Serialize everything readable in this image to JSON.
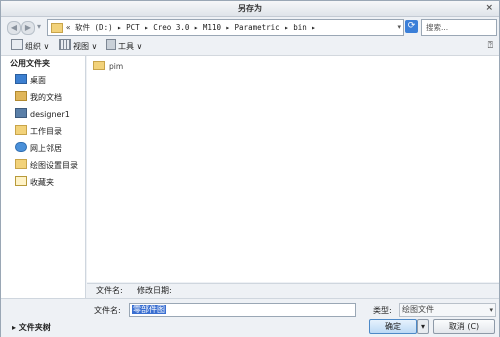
{
  "window": {
    "title": "另存为",
    "close_icon": "close-icon"
  },
  "nav": {
    "back_icon": "back-arrow-icon",
    "forward_icon": "forward-arrow-icon",
    "address_path": "« 软件 (D:) ▸ PCT ▸ Creo 3.0 ▸ M110 ▸ Parametric ▸ bin ▸",
    "search_placeholder": "搜索..."
  },
  "toolbar": {
    "organize": "组织 ∨",
    "views": "视图 ∨",
    "tools": "工具 ∨",
    "help_icon": "help-cursor-icon"
  },
  "sidebar": {
    "header": "公用文件夹",
    "items": [
      {
        "label": "桌面",
        "icon": "desktop-icon",
        "color": "#3c7fd0"
      },
      {
        "label": "我的文档",
        "icon": "documents-icon",
        "color": "#e0b65a"
      },
      {
        "label": "designer1",
        "icon": "computer-icon",
        "color": "#5a7fa8"
      },
      {
        "label": "工作目录",
        "icon": "folder-icon",
        "color": "#f2d27a"
      },
      {
        "label": "网上邻居",
        "icon": "network-icon",
        "color": "#4a90d9"
      },
      {
        "label": "绘图设置目录",
        "icon": "folder-icon",
        "color": "#f2d27a"
      },
      {
        "label": "收藏夹",
        "icon": "favorites-icon",
        "color": "#e6c24c"
      }
    ]
  },
  "files": [
    {
      "name": "pim",
      "icon": "folder-icon"
    }
  ],
  "details": {
    "name_col": "文件名:",
    "date_col": "修改日期:"
  },
  "bottom": {
    "filename_label": "文件名:",
    "filename_value": "零部件图",
    "type_label": "类型:",
    "type_value": "绘图文件",
    "folder_tree_toggle": "▸ 文件夹树",
    "ok_label": "确定",
    "cancel_label": "取消 (C)"
  }
}
